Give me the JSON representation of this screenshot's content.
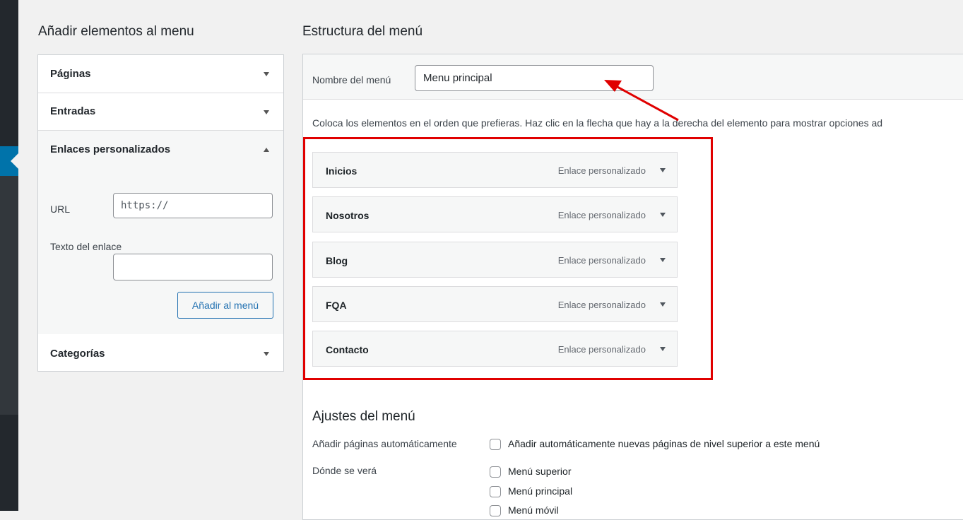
{
  "left_panel": {
    "title": "Añadir elementos al menu",
    "sections": [
      {
        "label": "Páginas",
        "state": "collapsed"
      },
      {
        "label": "Entradas",
        "state": "collapsed"
      },
      {
        "label": "Enlaces personalizados",
        "state": "expanded"
      },
      {
        "label": "Categorías",
        "state": "collapsed"
      }
    ],
    "custom_links": {
      "url_label": "URL",
      "url_value": "https://",
      "link_text_label": "Texto del enlace",
      "link_text_value": "",
      "add_button": "Añadir al menú"
    }
  },
  "structure": {
    "title": "Estructura del menú",
    "menu_name_label": "Nombre del menú",
    "menu_name_value": "Menu principal",
    "instructions": "Coloca los elementos en el orden que prefieras. Haz clic en la flecha que hay a la derecha del elemento para mostrar opciones ad",
    "items": [
      {
        "title": "Inicios",
        "type": "Enlace personalizado"
      },
      {
        "title": "Nosotros",
        "type": "Enlace personalizado"
      },
      {
        "title": "Blog",
        "type": "Enlace personalizado"
      },
      {
        "title": "FQA",
        "type": "Enlace personalizado"
      },
      {
        "title": "Contacto",
        "type": "Enlace personalizado"
      }
    ]
  },
  "settings": {
    "title": "Ajustes del menú",
    "auto_add_label": "Añadir páginas automáticamente",
    "auto_add_option": "Añadir automáticamente nuevas páginas de nivel superior a este menú",
    "location_label": "Dónde se verá",
    "locations": [
      "Menú superior",
      "Menú principal",
      "Menú móvil"
    ]
  },
  "colors": {
    "accent": "#0073aa",
    "sidebar": "#23282d",
    "annotation": "#e00000"
  }
}
